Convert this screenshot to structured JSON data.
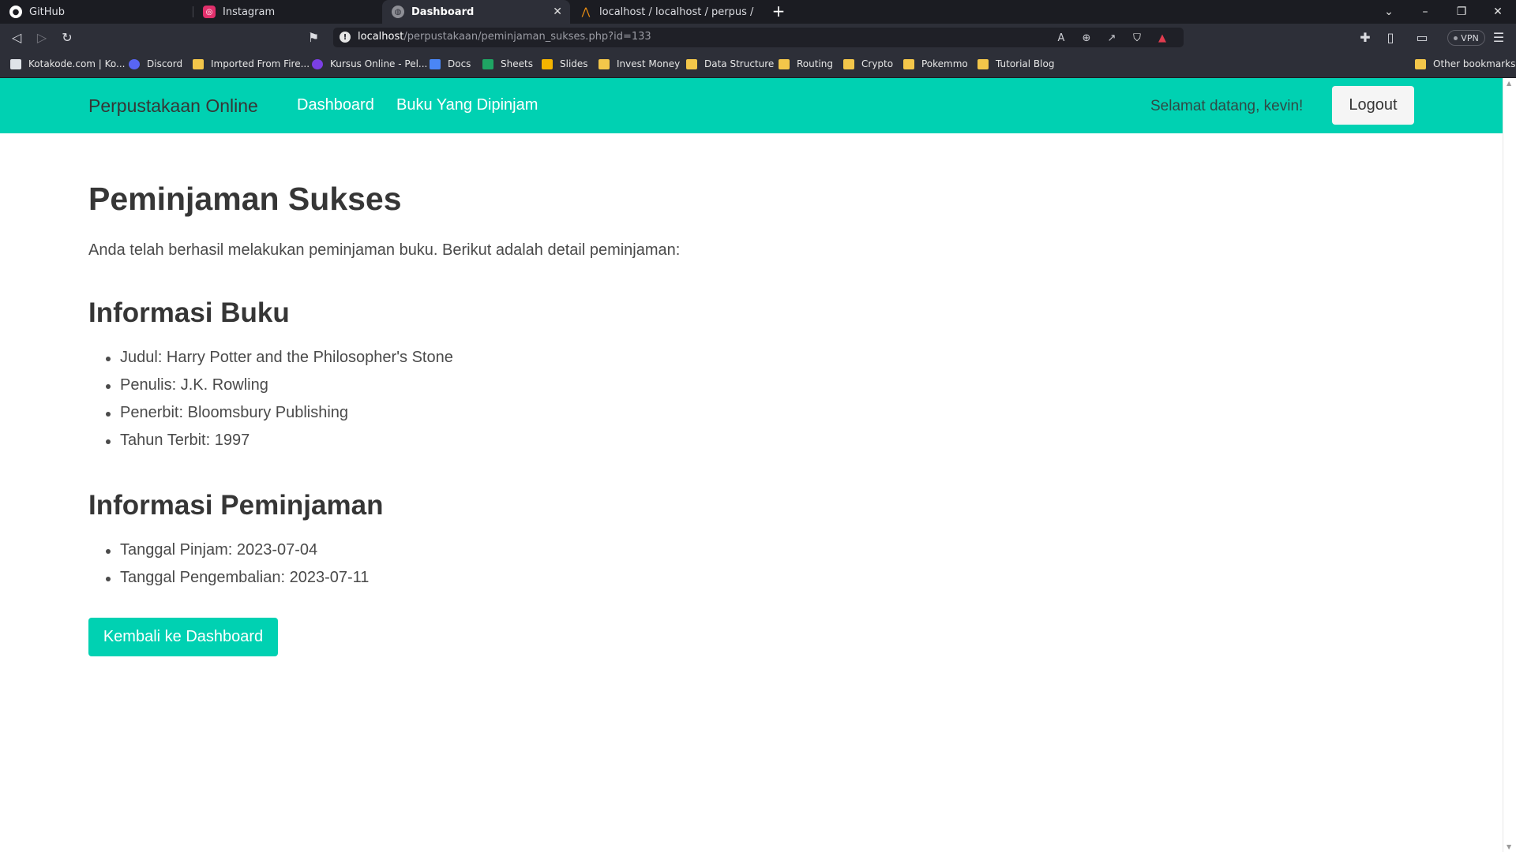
{
  "browser": {
    "tabs": [
      {
        "title": "GitHub",
        "icon": "github-icon",
        "active": false
      },
      {
        "title": "Instagram",
        "icon": "instagram-icon",
        "active": false
      },
      {
        "title": "Dashboard",
        "icon": "globe-icon",
        "active": true
      },
      {
        "title": "localhost / localhost / perpus / anggota",
        "icon": "phpmyadmin-icon",
        "active": false
      }
    ],
    "address": {
      "host": "localhost",
      "path": "/perpustakaan/peminjaman_sukses.php?id=133"
    },
    "vpn_label": "VPN",
    "bookmarks": [
      {
        "label": "Kotakode.com | Ko...",
        "icon": "kotakode-icon"
      },
      {
        "label": "Discord",
        "icon": "discord-icon"
      },
      {
        "label": "Imported From Fire...",
        "icon": "folder-icon"
      },
      {
        "label": "Kursus Online - Pel...",
        "icon": "kursus-icon"
      },
      {
        "label": "Docs",
        "icon": "docs-icon"
      },
      {
        "label": "Sheets",
        "icon": "sheets-icon"
      },
      {
        "label": "Slides",
        "icon": "slides-icon"
      },
      {
        "label": "Invest Money",
        "icon": "folder-icon"
      },
      {
        "label": "Data Structure",
        "icon": "folder-icon"
      },
      {
        "label": "Routing",
        "icon": "folder-icon"
      },
      {
        "label": "Crypto",
        "icon": "folder-icon"
      },
      {
        "label": "Pokemmo",
        "icon": "folder-icon"
      },
      {
        "label": "Tutorial Blog",
        "icon": "folder-icon"
      }
    ],
    "other_bookmarks": "Other bookmarks"
  },
  "navbar": {
    "brand": "Perpustakaan Online",
    "links": [
      "Dashboard",
      "Buku Yang Dipinjam"
    ],
    "welcome": "Selamat datang, kevin!",
    "logout": "Logout"
  },
  "page": {
    "title": "Peminjaman Sukses",
    "lead": "Anda telah berhasil melakukan peminjaman buku. Berikut adalah detail peminjaman:",
    "book_heading": "Informasi Buku",
    "book_items": [
      "Judul: Harry Potter and the Philosopher's Stone",
      "Penulis: J.K. Rowling",
      "Penerbit: Bloomsbury Publishing",
      "Tahun Terbit: 1997"
    ],
    "loan_heading": "Informasi Peminjaman",
    "loan_items": [
      "Tanggal Pinjam: 2023-07-04",
      "Tanggal Pengembalian: 2023-07-11"
    ],
    "back_button": "Kembali ke Dashboard"
  },
  "colors": {
    "primary": "#00d1b2",
    "text_dark": "#363636",
    "text": "#4a4a4a",
    "chrome_dark": "#1b1c22",
    "chrome": "#2d2f38"
  }
}
